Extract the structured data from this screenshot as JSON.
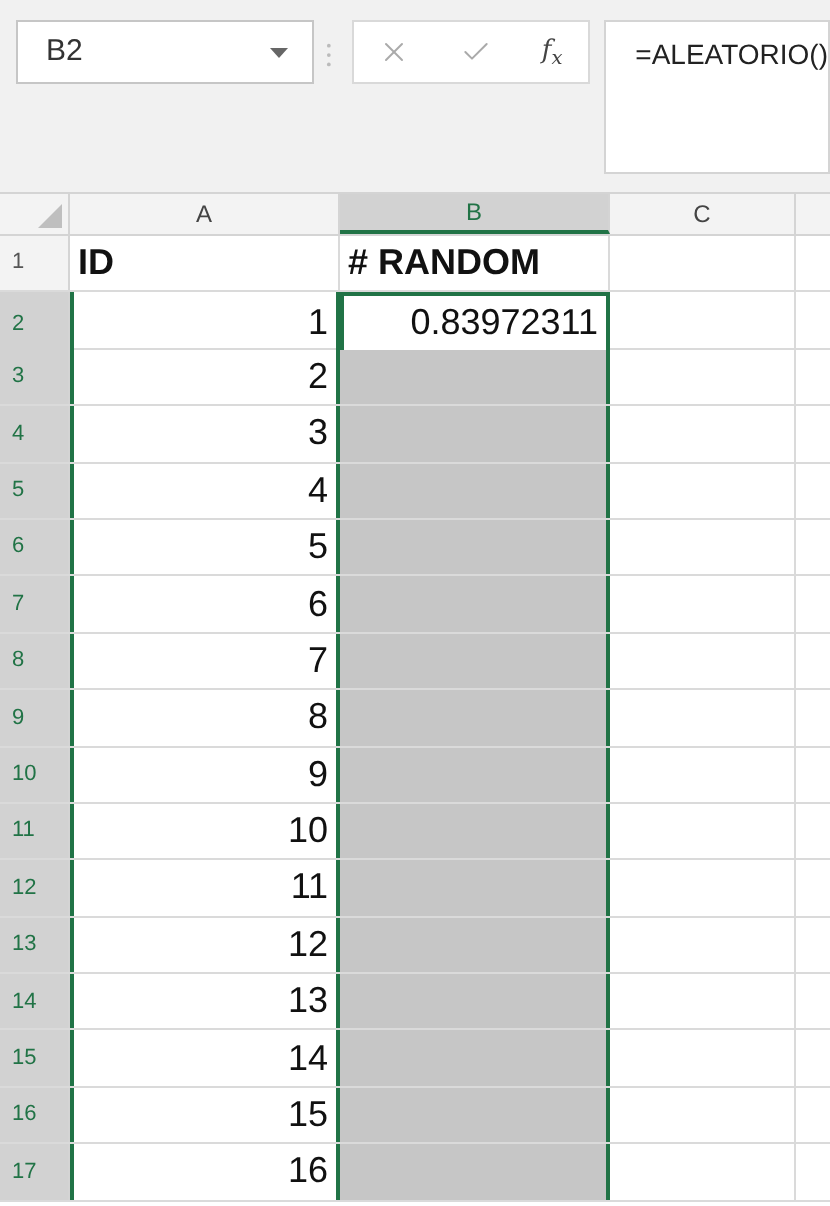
{
  "name_box": {
    "value": "B2"
  },
  "formula_bar": {
    "function_label": "f$_{x}$",
    "value": "=ALEATORIO()"
  },
  "columns": [
    {
      "label": "A",
      "selected": false
    },
    {
      "label": "B",
      "selected": true
    },
    {
      "label": "C",
      "selected": false
    }
  ],
  "rows": [
    {
      "number": "1",
      "kind": "header",
      "selected": false,
      "active": false,
      "a": "ID",
      "b": "# RANDOM"
    },
    {
      "number": "2",
      "kind": "data",
      "selected": true,
      "active": true,
      "a": "1",
      "b": "0.83972311"
    },
    {
      "number": "3",
      "kind": "data",
      "selected": true,
      "active": false,
      "a": "2"
    },
    {
      "number": "4",
      "kind": "data",
      "selected": true,
      "active": false,
      "a": "3"
    },
    {
      "number": "5",
      "kind": "data",
      "selected": true,
      "active": false,
      "a": "4"
    },
    {
      "number": "6",
      "kind": "data",
      "selected": true,
      "active": false,
      "a": "5"
    },
    {
      "number": "7",
      "kind": "data",
      "selected": true,
      "active": false,
      "a": "6"
    },
    {
      "number": "8",
      "kind": "data",
      "selected": true,
      "active": false,
      "a": "7"
    },
    {
      "number": "9",
      "kind": "data",
      "selected": true,
      "active": false,
      "a": "8"
    },
    {
      "number": "10",
      "kind": "data",
      "selected": true,
      "active": false,
      "a": "9"
    },
    {
      "number": "11",
      "kind": "data",
      "selected": true,
      "active": false,
      "a": "10"
    },
    {
      "number": "12",
      "kind": "data",
      "selected": true,
      "active": false,
      "a": "11"
    },
    {
      "number": "13",
      "kind": "data",
      "selected": true,
      "active": false,
      "a": "12"
    },
    {
      "number": "14",
      "kind": "data",
      "selected": true,
      "active": false,
      "a": "13"
    },
    {
      "number": "15",
      "kind": "data",
      "selected": true,
      "active": false,
      "a": "14"
    },
    {
      "number": "16",
      "kind": "data",
      "selected": true,
      "active": false,
      "a": "15"
    },
    {
      "number": "17",
      "kind": "data",
      "selected": true,
      "active": false,
      "a": "16"
    }
  ]
}
